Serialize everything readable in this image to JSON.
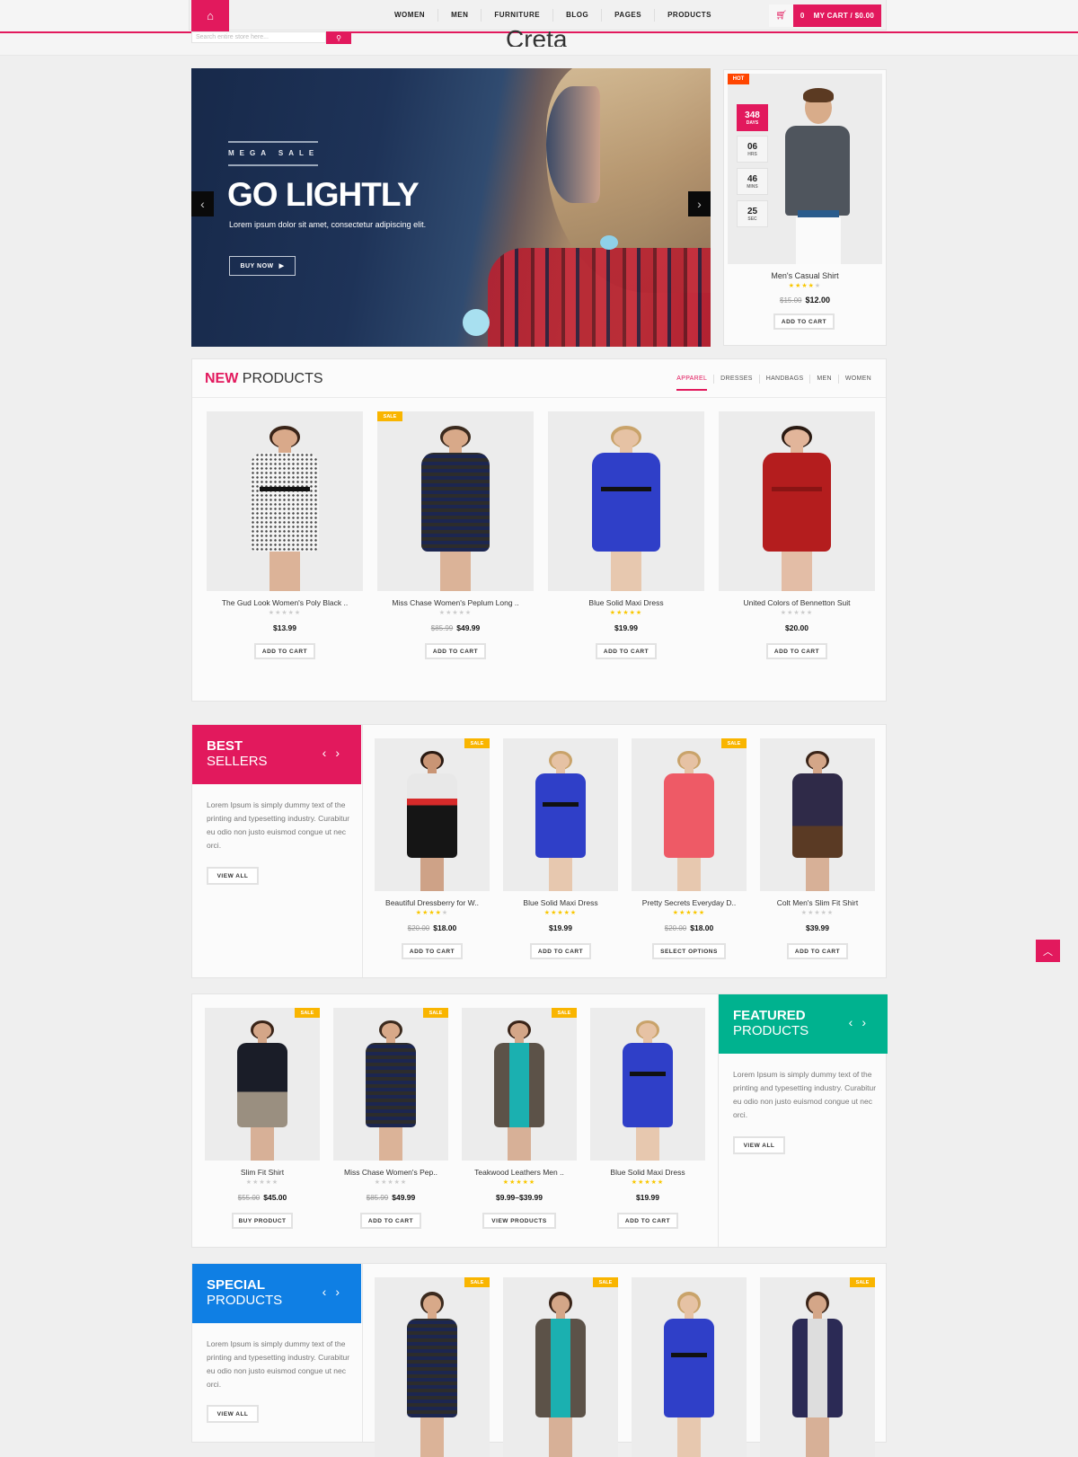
{
  "header": {
    "home_icon": "home-icon",
    "nav": [
      "WOMEN",
      "MEN",
      "FURNITURE",
      "BLOG",
      "PAGES",
      "PRODUCTS"
    ],
    "cart_icon": "shopping-cart-icon",
    "cart_count": "0",
    "cart_label": "MY CART / $0.00",
    "search_placeholder": "Search entire store here...",
    "search_icon": "search-icon",
    "logo": "Creta"
  },
  "hero": {
    "kicker": "MEGA SALE",
    "title": "GO LIGHTLY",
    "subtitle": "Lorem ipsum dolor sit amet, consectetur adipiscing elit.",
    "button": "BUY NOW",
    "prev": "‹",
    "next": "›"
  },
  "deal": {
    "badge": "HOT",
    "countdown": [
      {
        "value": "348",
        "unit": "DAYS"
      },
      {
        "value": "06",
        "unit": "HRS"
      },
      {
        "value": "46",
        "unit": "MINS"
      },
      {
        "value": "25",
        "unit": "SEC"
      }
    ],
    "name": "Men's Casual Shirt",
    "rating": 4,
    "old_price": "$15.00",
    "price": "$12.00",
    "button": "ADD TO CART"
  },
  "new_products": {
    "title_bold": "NEW",
    "title_rest": " PRODUCTS",
    "tabs": [
      "APPAREL",
      "DRESSES",
      "HANDBAGS",
      "MEN",
      "WOMEN"
    ],
    "active_tab": "APPAREL",
    "items": [
      {
        "name": "The Gud Look Women's Poly Black ..",
        "rating": 0,
        "old_price": "",
        "price": "$13.99",
        "button": "ADD TO CART",
        "sale": false
      },
      {
        "name": "Miss Chase Women's Peplum Long ..",
        "rating": 0,
        "old_price": "$85.99",
        "price": "$49.99",
        "button": "ADD TO CART",
        "sale": true
      },
      {
        "name": "Blue Solid Maxi Dress",
        "rating": 5,
        "old_price": "",
        "price": "$19.99",
        "button": "ADD TO CART",
        "sale": false
      },
      {
        "name": "United Colors of Bennetton Suit",
        "rating": 0,
        "old_price": "",
        "price": "$20.00",
        "button": "ADD TO CART",
        "sale": false
      }
    ]
  },
  "best_sellers": {
    "title_bold": "BEST",
    "title_rest": "SELLERS",
    "color": "#e2195d",
    "text": "Lorem Ipsum is simply dummy text of the printing and typesetting industry. Curabitur eu odio non justo euismod congue ut nec orci.",
    "button": "VIEW ALL",
    "items": [
      {
        "name": "Beautiful Dressberry for W..",
        "rating": 4,
        "old_price": "$20.00",
        "price": "$18.00",
        "button": "ADD TO CART",
        "sale": true
      },
      {
        "name": "Blue Solid Maxi Dress",
        "rating": 5,
        "old_price": "",
        "price": "$19.99",
        "button": "ADD TO CART",
        "sale": false
      },
      {
        "name": "Pretty Secrets Everyday D..",
        "rating": 4.5,
        "old_price": "$20.00",
        "price": "$18.00",
        "button": "SELECT OPTIONS",
        "sale": true
      },
      {
        "name": "Colt Men's Slim Fit Shirt",
        "rating": 0,
        "old_price": "",
        "price": "$39.99",
        "button": "ADD TO CART",
        "sale": false
      }
    ]
  },
  "featured": {
    "title_bold": "FEATURED",
    "title_rest": "PRODUCTS",
    "color": "#00b28f",
    "text": "Lorem Ipsum is simply dummy text of the printing and typesetting industry. Curabitur eu odio non justo euismod congue ut nec orci.",
    "button": "VIEW ALL",
    "items": [
      {
        "name": "Slim Fit Shirt",
        "rating": 0,
        "old_price": "$55.00",
        "price": "$45.00",
        "button": "BUY PRODUCT",
        "sale": true
      },
      {
        "name": "Miss Chase Women's Pep..",
        "rating": 0,
        "old_price": "$85.99",
        "price": "$49.99",
        "button": "ADD TO CART",
        "sale": true
      },
      {
        "name": "Teakwood Leathers Men ..",
        "rating": 4.5,
        "old_price": "",
        "price": "$9.99–$39.99",
        "button": "VIEW PRODUCTS",
        "sale": true
      },
      {
        "name": "Blue Solid Maxi Dress",
        "rating": 5,
        "old_price": "",
        "price": "$19.99",
        "button": "ADD TO CART",
        "sale": false
      }
    ]
  },
  "special": {
    "title_bold": "SPECIAL",
    "title_rest": "PRODUCTS",
    "color": "#0f7fe4",
    "text": "Lorem Ipsum is simply dummy text of the printing and typesetting industry. Curabitur eu odio non justo euismod congue ut nec orci.",
    "button": "VIEW ALL",
    "items": [
      {
        "sale": true
      },
      {
        "sale": true
      },
      {
        "sale": false
      },
      {
        "sale": true
      }
    ]
  },
  "sale_label": "SALE",
  "arrows": {
    "prev": "‹",
    "next": "›"
  },
  "back_to_top_icon": "chevron-up-icon",
  "accent_color": "#e2195d",
  "sale_color": "#f9b500",
  "hot_color": "#ff4500",
  "star_color": "#f9c700"
}
